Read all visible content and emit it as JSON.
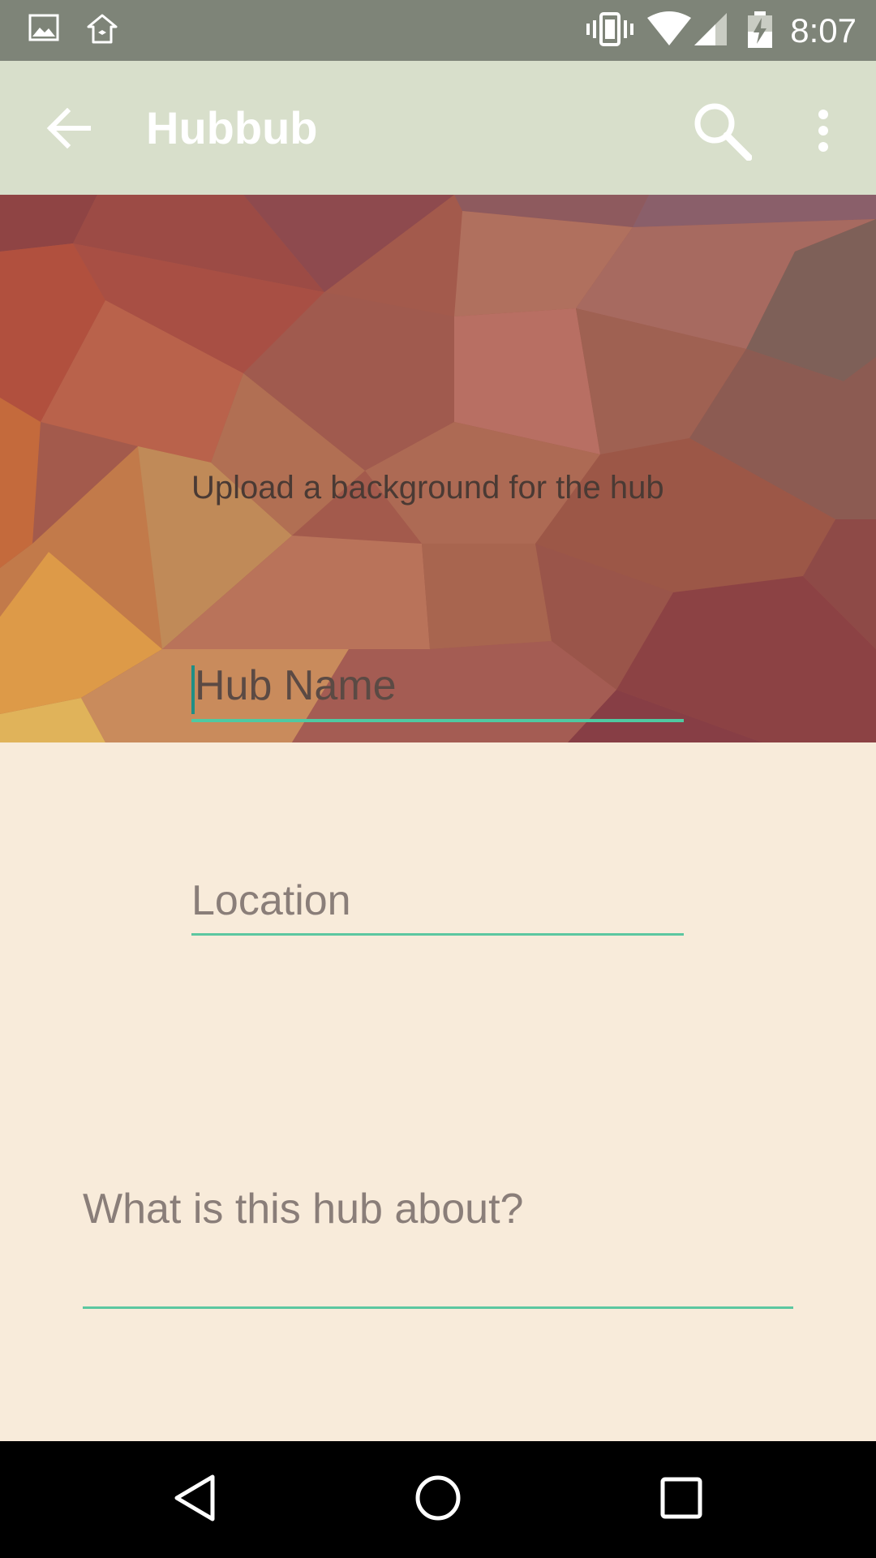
{
  "status_bar": {
    "time": "8:07",
    "left_icons": [
      "image-icon",
      "home-sync-icon"
    ],
    "right_icons": [
      "vibrate-icon",
      "wifi-icon",
      "signal-icon",
      "battery-charging-icon"
    ]
  },
  "app_bar": {
    "title": "Hubbub",
    "back_icon": "arrow-back-icon",
    "actions": [
      "search-icon",
      "more-vert-icon"
    ],
    "background": "#D8DFCB"
  },
  "hero": {
    "upload_text": "Upload a background for the hub"
  },
  "form": {
    "hub_name_placeholder": "Hub Name",
    "location_placeholder": "Location",
    "about_placeholder": "What is this hub about?"
  },
  "nav_bar": {
    "buttons": [
      "back-triangle-icon",
      "home-circle-icon",
      "recents-square-icon"
    ]
  },
  "colors": {
    "accent": "#4FC9A1",
    "page_background": "#F8EBDA",
    "status_bar": "#7E8478"
  }
}
